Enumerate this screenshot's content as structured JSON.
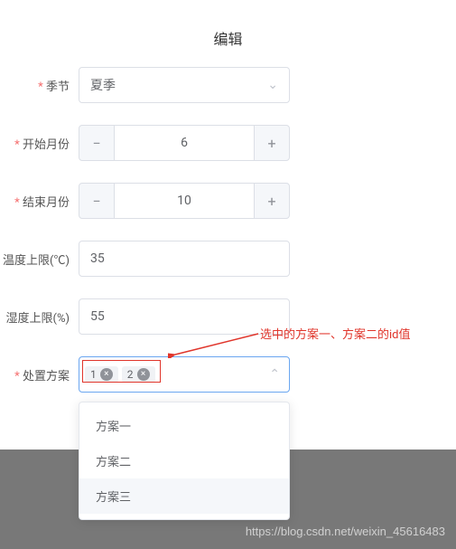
{
  "title": "编辑",
  "fields": {
    "season": {
      "label": "季节",
      "value": "夏季"
    },
    "startMonth": {
      "label": "开始月份",
      "value": "6"
    },
    "endMonth": {
      "label": "结束月份",
      "value": "10"
    },
    "tempLimit": {
      "label": "温度上限(℃)",
      "value": "35"
    },
    "humidLimit": {
      "label": "湿度上限(%)",
      "value": "55"
    },
    "plan": {
      "label": "处置方案",
      "tags": [
        "1",
        "2"
      ]
    }
  },
  "dropdown": {
    "items": [
      "方案一",
      "方案二",
      "方案三"
    ]
  },
  "annotation": "选中的方案一、方案二的id值",
  "watermark": "https://blog.csdn.net/weixin_45616483",
  "glyphs": {
    "minus": "−",
    "plus": "+",
    "close": "×",
    "chevDown": "⌄",
    "chevUp": "⌃"
  }
}
